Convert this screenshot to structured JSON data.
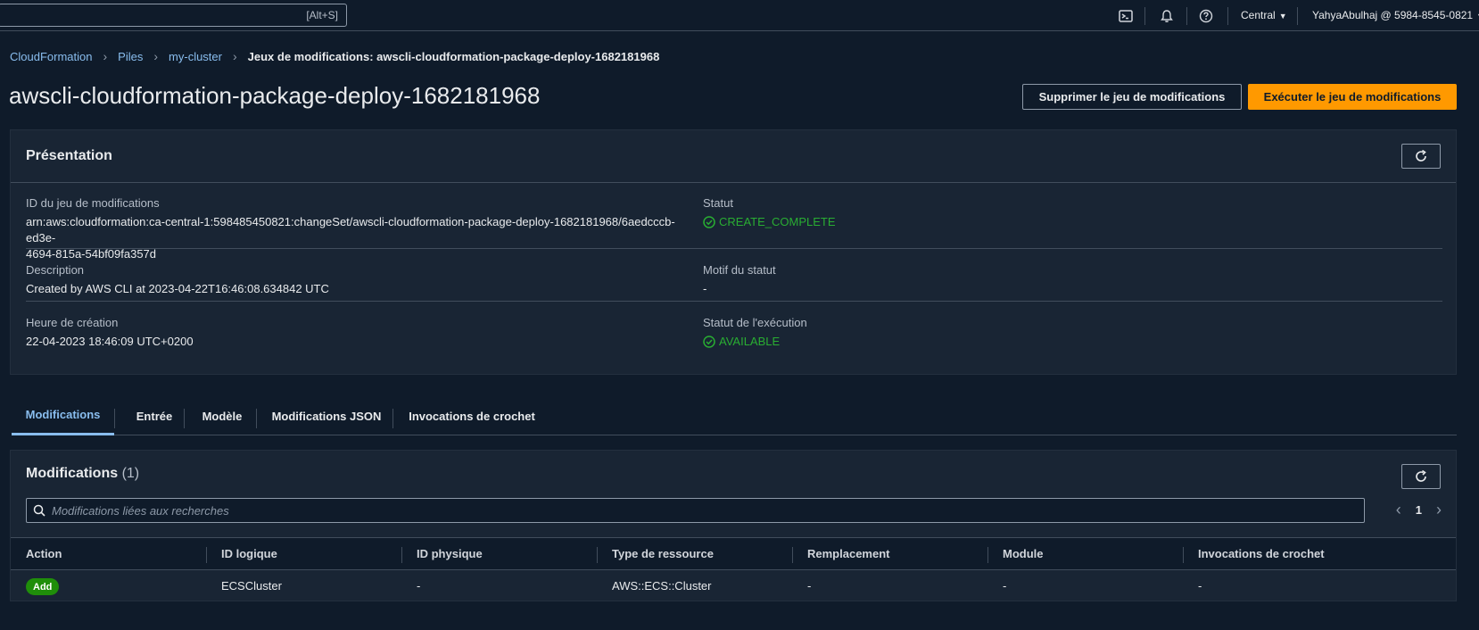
{
  "topbar": {
    "search_shortcut": "[Alt+S]",
    "region": "Central",
    "account": "YahyaAbulhaj @ 5984-8545-0821",
    "icons": [
      "terminal-icon",
      "bell-icon",
      "help-icon"
    ]
  },
  "breadcrumb": {
    "items": [
      "CloudFormation",
      "Piles",
      "my-cluster"
    ],
    "current": "Jeux de modifications: awscli-cloudformation-package-deploy-1682181968"
  },
  "page_title": "awscli-cloudformation-package-deploy-1682181968",
  "actions": {
    "delete_label": "Supprimer le jeu de modifications",
    "execute_label": "Exécuter le jeu de modifications"
  },
  "overview": {
    "title": "Présentation",
    "changeset_id_label": "ID du jeu de modifications",
    "changeset_id_line1": "arn:aws:cloudformation:ca-central-1:598485450821:changeSet/awscli-cloudformation-package-deploy-1682181968/6aedcccb-ed3e-",
    "changeset_id_line2": "4694-815a-54bf09fa357d",
    "status_label": "Statut",
    "status_value": "CREATE_COMPLETE",
    "description_label": "Description",
    "description_value": "Created by AWS CLI at 2023-04-22T16:46:08.634842 UTC",
    "status_reason_label": "Motif du statut",
    "status_reason_value": "-",
    "created_label": "Heure de création",
    "created_value": "22-04-2023 18:46:09 UTC+0200",
    "exec_status_label": "Statut de l'exécution",
    "exec_status_value": "AVAILABLE"
  },
  "tabs": [
    "Modifications",
    "Entrée",
    "Modèle",
    "Modifications JSON",
    "Invocations de crochet"
  ],
  "modifications": {
    "title": "Modifications",
    "count": "(1)",
    "search_placeholder": "Modifications liées aux recherches",
    "page": "1",
    "columns": [
      "Action",
      "ID logique",
      "ID physique",
      "Type de ressource",
      "Remplacement",
      "Module",
      "Invocations de crochet"
    ],
    "rows": [
      {
        "action": "Add",
        "logical_id": "ECSCluster",
        "physical_id": "-",
        "resource_type": "AWS::ECS::Cluster",
        "replacement": "-",
        "module": "-",
        "hook_invocations": "-"
      }
    ]
  },
  "colors": {
    "accent": "#ff9900",
    "link": "#89bdee",
    "success": "#29ad32",
    "badge_add": "#1f8e0a"
  }
}
